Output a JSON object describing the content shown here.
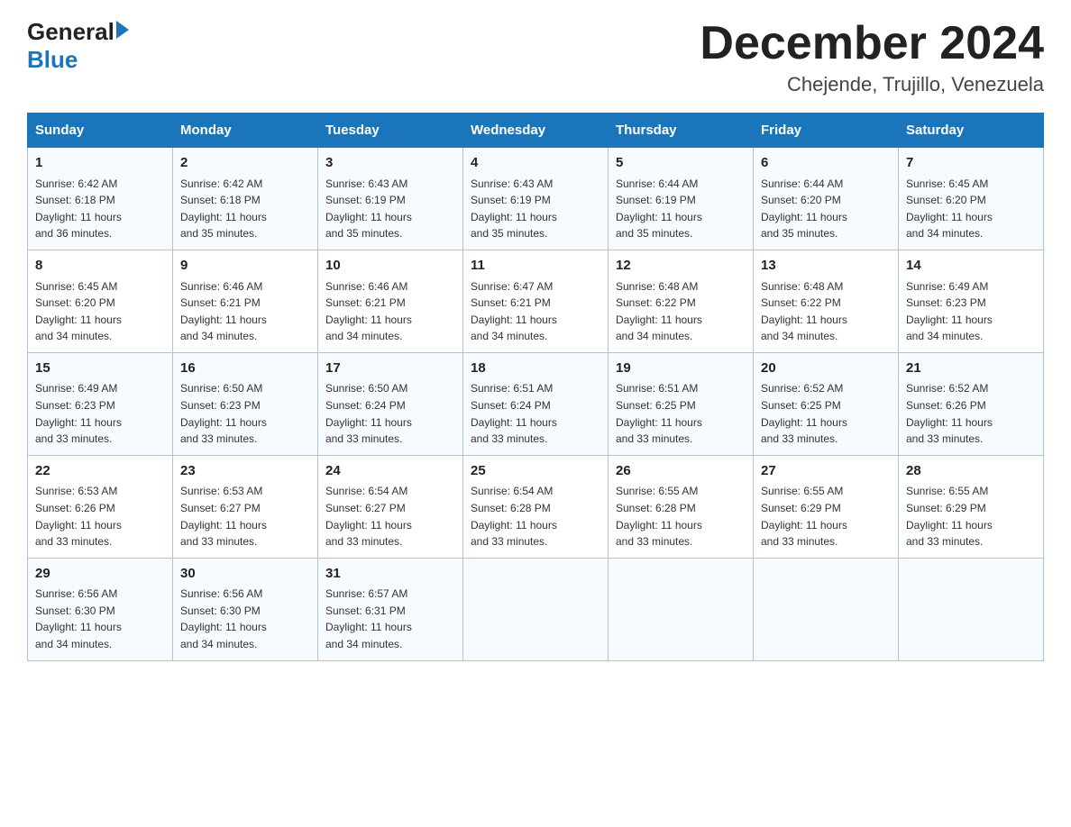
{
  "header": {
    "logo_general": "General",
    "logo_blue": "Blue",
    "month_title": "December 2024",
    "location": "Chejende, Trujillo, Venezuela"
  },
  "weekdays": [
    "Sunday",
    "Monday",
    "Tuesday",
    "Wednesday",
    "Thursday",
    "Friday",
    "Saturday"
  ],
  "weeks": [
    [
      {
        "day": "1",
        "sunrise": "6:42 AM",
        "sunset": "6:18 PM",
        "daylight": "11 hours and 36 minutes."
      },
      {
        "day": "2",
        "sunrise": "6:42 AM",
        "sunset": "6:18 PM",
        "daylight": "11 hours and 35 minutes."
      },
      {
        "day": "3",
        "sunrise": "6:43 AM",
        "sunset": "6:19 PM",
        "daylight": "11 hours and 35 minutes."
      },
      {
        "day": "4",
        "sunrise": "6:43 AM",
        "sunset": "6:19 PM",
        "daylight": "11 hours and 35 minutes."
      },
      {
        "day": "5",
        "sunrise": "6:44 AM",
        "sunset": "6:19 PM",
        "daylight": "11 hours and 35 minutes."
      },
      {
        "day": "6",
        "sunrise": "6:44 AM",
        "sunset": "6:20 PM",
        "daylight": "11 hours and 35 minutes."
      },
      {
        "day": "7",
        "sunrise": "6:45 AM",
        "sunset": "6:20 PM",
        "daylight": "11 hours and 34 minutes."
      }
    ],
    [
      {
        "day": "8",
        "sunrise": "6:45 AM",
        "sunset": "6:20 PM",
        "daylight": "11 hours and 34 minutes."
      },
      {
        "day": "9",
        "sunrise": "6:46 AM",
        "sunset": "6:21 PM",
        "daylight": "11 hours and 34 minutes."
      },
      {
        "day": "10",
        "sunrise": "6:46 AM",
        "sunset": "6:21 PM",
        "daylight": "11 hours and 34 minutes."
      },
      {
        "day": "11",
        "sunrise": "6:47 AM",
        "sunset": "6:21 PM",
        "daylight": "11 hours and 34 minutes."
      },
      {
        "day": "12",
        "sunrise": "6:48 AM",
        "sunset": "6:22 PM",
        "daylight": "11 hours and 34 minutes."
      },
      {
        "day": "13",
        "sunrise": "6:48 AM",
        "sunset": "6:22 PM",
        "daylight": "11 hours and 34 minutes."
      },
      {
        "day": "14",
        "sunrise": "6:49 AM",
        "sunset": "6:23 PM",
        "daylight": "11 hours and 34 minutes."
      }
    ],
    [
      {
        "day": "15",
        "sunrise": "6:49 AM",
        "sunset": "6:23 PM",
        "daylight": "11 hours and 33 minutes."
      },
      {
        "day": "16",
        "sunrise": "6:50 AM",
        "sunset": "6:23 PM",
        "daylight": "11 hours and 33 minutes."
      },
      {
        "day": "17",
        "sunrise": "6:50 AM",
        "sunset": "6:24 PM",
        "daylight": "11 hours and 33 minutes."
      },
      {
        "day": "18",
        "sunrise": "6:51 AM",
        "sunset": "6:24 PM",
        "daylight": "11 hours and 33 minutes."
      },
      {
        "day": "19",
        "sunrise": "6:51 AM",
        "sunset": "6:25 PM",
        "daylight": "11 hours and 33 minutes."
      },
      {
        "day": "20",
        "sunrise": "6:52 AM",
        "sunset": "6:25 PM",
        "daylight": "11 hours and 33 minutes."
      },
      {
        "day": "21",
        "sunrise": "6:52 AM",
        "sunset": "6:26 PM",
        "daylight": "11 hours and 33 minutes."
      }
    ],
    [
      {
        "day": "22",
        "sunrise": "6:53 AM",
        "sunset": "6:26 PM",
        "daylight": "11 hours and 33 minutes."
      },
      {
        "day": "23",
        "sunrise": "6:53 AM",
        "sunset": "6:27 PM",
        "daylight": "11 hours and 33 minutes."
      },
      {
        "day": "24",
        "sunrise": "6:54 AM",
        "sunset": "6:27 PM",
        "daylight": "11 hours and 33 minutes."
      },
      {
        "day": "25",
        "sunrise": "6:54 AM",
        "sunset": "6:28 PM",
        "daylight": "11 hours and 33 minutes."
      },
      {
        "day": "26",
        "sunrise": "6:55 AM",
        "sunset": "6:28 PM",
        "daylight": "11 hours and 33 minutes."
      },
      {
        "day": "27",
        "sunrise": "6:55 AM",
        "sunset": "6:29 PM",
        "daylight": "11 hours and 33 minutes."
      },
      {
        "day": "28",
        "sunrise": "6:55 AM",
        "sunset": "6:29 PM",
        "daylight": "11 hours and 33 minutes."
      }
    ],
    [
      {
        "day": "29",
        "sunrise": "6:56 AM",
        "sunset": "6:30 PM",
        "daylight": "11 hours and 34 minutes."
      },
      {
        "day": "30",
        "sunrise": "6:56 AM",
        "sunset": "6:30 PM",
        "daylight": "11 hours and 34 minutes."
      },
      {
        "day": "31",
        "sunrise": "6:57 AM",
        "sunset": "6:31 PM",
        "daylight": "11 hours and 34 minutes."
      },
      null,
      null,
      null,
      null
    ]
  ],
  "labels": {
    "sunrise": "Sunrise:",
    "sunset": "Sunset:",
    "daylight": "Daylight:"
  }
}
